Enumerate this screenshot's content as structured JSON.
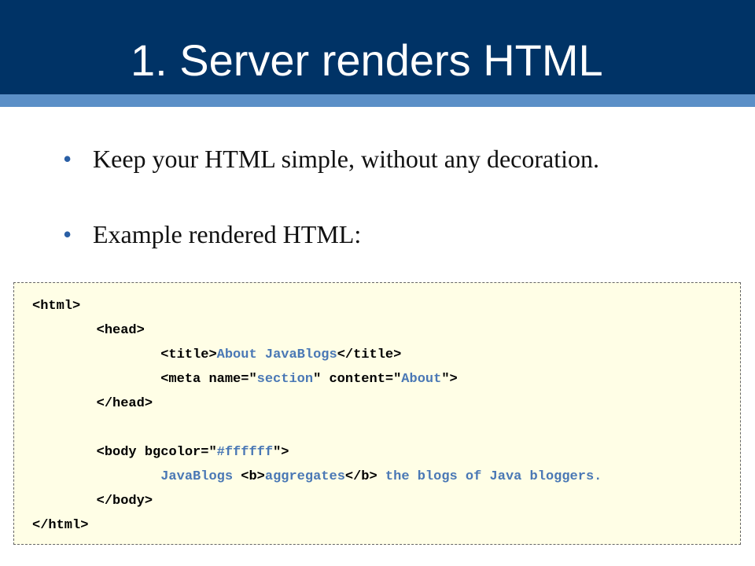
{
  "slide": {
    "title": "1. Server renders HTML",
    "bullets": [
      "Keep your HTML simple, without any decoration.",
      "Example rendered HTML:"
    ]
  },
  "code": {
    "lines": [
      {
        "indent": 0,
        "parts": [
          {
            "t": "tag",
            "s": "<html>"
          }
        ]
      },
      {
        "indent": 1,
        "parts": [
          {
            "t": "tag",
            "s": "<head>"
          }
        ]
      },
      {
        "indent": 2,
        "parts": [
          {
            "t": "tag",
            "s": "<title>"
          },
          {
            "t": "val",
            "s": "About JavaBlogs"
          },
          {
            "t": "tag",
            "s": "</title>"
          }
        ]
      },
      {
        "indent": 2,
        "parts": [
          {
            "t": "tag",
            "s": "<meta name=\""
          },
          {
            "t": "val",
            "s": "section"
          },
          {
            "t": "tag",
            "s": "\" content=\""
          },
          {
            "t": "val",
            "s": "About"
          },
          {
            "t": "tag",
            "s": "\">"
          }
        ]
      },
      {
        "indent": 1,
        "parts": [
          {
            "t": "tag",
            "s": "</head>"
          }
        ]
      },
      {
        "indent": 0,
        "parts": []
      },
      {
        "indent": 1,
        "parts": [
          {
            "t": "tag",
            "s": "<body bgcolor=\""
          },
          {
            "t": "val",
            "s": "#ffffff"
          },
          {
            "t": "tag",
            "s": "\">"
          }
        ]
      },
      {
        "indent": 2,
        "parts": [
          {
            "t": "val",
            "s": "JavaBlogs "
          },
          {
            "t": "tag",
            "s": "<b>"
          },
          {
            "t": "val",
            "s": "aggregates"
          },
          {
            "t": "tag",
            "s": "</b>"
          },
          {
            "t": "val",
            "s": " the blogs of Java bloggers."
          }
        ]
      },
      {
        "indent": 1,
        "parts": [
          {
            "t": "tag",
            "s": "</body>"
          }
        ]
      },
      {
        "indent": 0,
        "parts": [
          {
            "t": "tag",
            "s": "</html>"
          }
        ]
      }
    ]
  },
  "colors": {
    "header_bg": "#003366",
    "header_stripe": "#5b8fc7",
    "bullet_dot": "#2a5fa5",
    "code_bg": "#fffee6",
    "code_value": "#4a78b5"
  }
}
